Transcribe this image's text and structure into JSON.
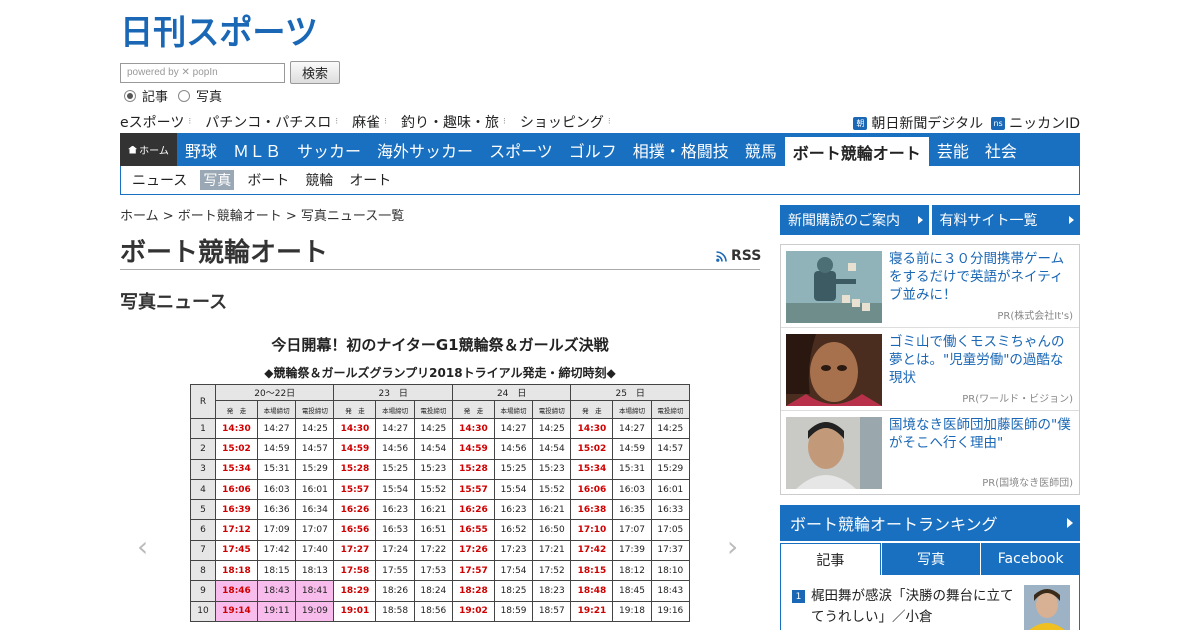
{
  "site": {
    "logo_text": "日刊スポーツ"
  },
  "search": {
    "placeholder": "powered by ✕ popIn",
    "button_label": "検索",
    "options": [
      {
        "label": "記事",
        "selected": true
      },
      {
        "label": "写真",
        "selected": false
      }
    ]
  },
  "subnav": {
    "items": [
      "eスポーツ",
      "パチンコ・パチスロ",
      "麻雀",
      "釣り・趣味・旅",
      "ショッピング"
    ],
    "right": [
      {
        "badge": "朝",
        "label": "朝日新聞デジタル"
      },
      {
        "badge": "ns",
        "label": "ニッカンID"
      }
    ]
  },
  "global_nav": {
    "home_label": "ホーム",
    "items": [
      "野球",
      "ＭＬＢ",
      "サッカー",
      "海外サッカー",
      "スポーツ",
      "ゴルフ",
      "相撲・格闘技",
      "競馬",
      "ボート競輪オート",
      "芸能",
      "社会"
    ],
    "active": "ボート競輪オート"
  },
  "local_nav": {
    "items": [
      "ニュース",
      "写真",
      "ボート",
      "競輪",
      "オート"
    ],
    "active": "写真"
  },
  "breadcrumb": "ホーム > ボート競輪オート > 写真ニュース一覧",
  "page_title": "ボート競輪オート",
  "rss_label": "RSS",
  "section_title": "写真ニュース",
  "carousel": {
    "prev_label": "‹",
    "next_label": "›"
  },
  "photo": {
    "title": "今日開幕！初のナイターG1競輪祭＆ガールズ決戦",
    "subtitle": "◆競輪祭＆ガールズグランプリ2018トライアル発走・締切時刻◆",
    "table": {
      "race_header": "R",
      "day_headers": [
        "20～22日",
        "23　日",
        "24　日",
        "25　日"
      ],
      "sub_headers": [
        "発　走",
        "本場締切",
        "電投締切"
      ],
      "rows": [
        {
          "r": "1",
          "cells": [
            "14:30",
            "14:27",
            "14:25",
            "14:30",
            "14:27",
            "14:25",
            "14:30",
            "14:27",
            "14:25",
            "14:30",
            "14:27",
            "14:25"
          ]
        },
        {
          "r": "2",
          "cells": [
            "15:02",
            "14:59",
            "14:57",
            "14:59",
            "14:56",
            "14:54",
            "14:59",
            "14:56",
            "14:54",
            "15:02",
            "14:59",
            "14:57"
          ]
        },
        {
          "r": "3",
          "cells": [
            "15:34",
            "15:31",
            "15:29",
            "15:28",
            "15:25",
            "15:23",
            "15:28",
            "15:25",
            "15:23",
            "15:34",
            "15:31",
            "15:29"
          ]
        },
        {
          "r": "4",
          "cells": [
            "16:06",
            "16:03",
            "16:01",
            "15:57",
            "15:54",
            "15:52",
            "15:57",
            "15:54",
            "15:52",
            "16:06",
            "16:03",
            "16:01"
          ]
        },
        {
          "r": "5",
          "cells": [
            "16:39",
            "16:36",
            "16:34",
            "16:26",
            "16:23",
            "16:21",
            "16:26",
            "16:23",
            "16:21",
            "16:38",
            "16:35",
            "16:33"
          ]
        },
        {
          "r": "6",
          "cells": [
            "17:12",
            "17:09",
            "17:07",
            "16:56",
            "16:53",
            "16:51",
            "16:55",
            "16:52",
            "16:50",
            "17:10",
            "17:07",
            "17:05"
          ]
        },
        {
          "r": "7",
          "cells": [
            "17:45",
            "17:42",
            "17:40",
            "17:27",
            "17:24",
            "17:22",
            "17:26",
            "17:23",
            "17:21",
            "17:42",
            "17:39",
            "17:37"
          ]
        },
        {
          "r": "8",
          "cells": [
            "18:18",
            "18:15",
            "18:13",
            "17:58",
            "17:55",
            "17:53",
            "17:57",
            "17:54",
            "17:52",
            "18:15",
            "18:12",
            "18:10"
          ]
        },
        {
          "r": "9",
          "cells": [
            "18:46",
            "18:43",
            "18:41",
            "18:29",
            "18:26",
            "18:24",
            "18:28",
            "18:25",
            "18:23",
            "18:48",
            "18:45",
            "18:43"
          ]
        },
        {
          "r": "10",
          "cells": [
            "19:14",
            "19:11",
            "19:09",
            "19:01",
            "18:58",
            "18:56",
            "19:02",
            "18:59",
            "18:57",
            "19:21",
            "19:18",
            "19:16"
          ]
        }
      ]
    }
  },
  "sidebar": {
    "buttons": [
      "新聞購読のご案内",
      "有料サイト一覧"
    ],
    "pr_items": [
      {
        "text": "寝る前に３０分間携帯ゲームをするだけで英語がネイティブ並みに！",
        "source": "PR(株式会社It's)"
      },
      {
        "text": "ゴミ山で働くモスミちゃんの夢とは。\"児童労働\"の過酷な現状",
        "source": "PR(ワールド・ビジョン)"
      },
      {
        "text": "国境なき医師団加藤医師の\"僕がそこへ行く理由\"",
        "source": "PR(国境なき医師団)"
      }
    ],
    "ranking": {
      "title": "ボート競輪オートランキング",
      "tabs": [
        "記事",
        "写真",
        "Facebook"
      ],
      "active_tab": "記事",
      "items": [
        {
          "rank": "1",
          "text": "梶田舞が感涙「決勝の舞台に立ててうれしい」／小倉"
        }
      ]
    }
  },
  "colors": {
    "brand_blue": "#1a70c0",
    "race_red": "#d00000",
    "highlight_pink": "#f7bcec"
  }
}
